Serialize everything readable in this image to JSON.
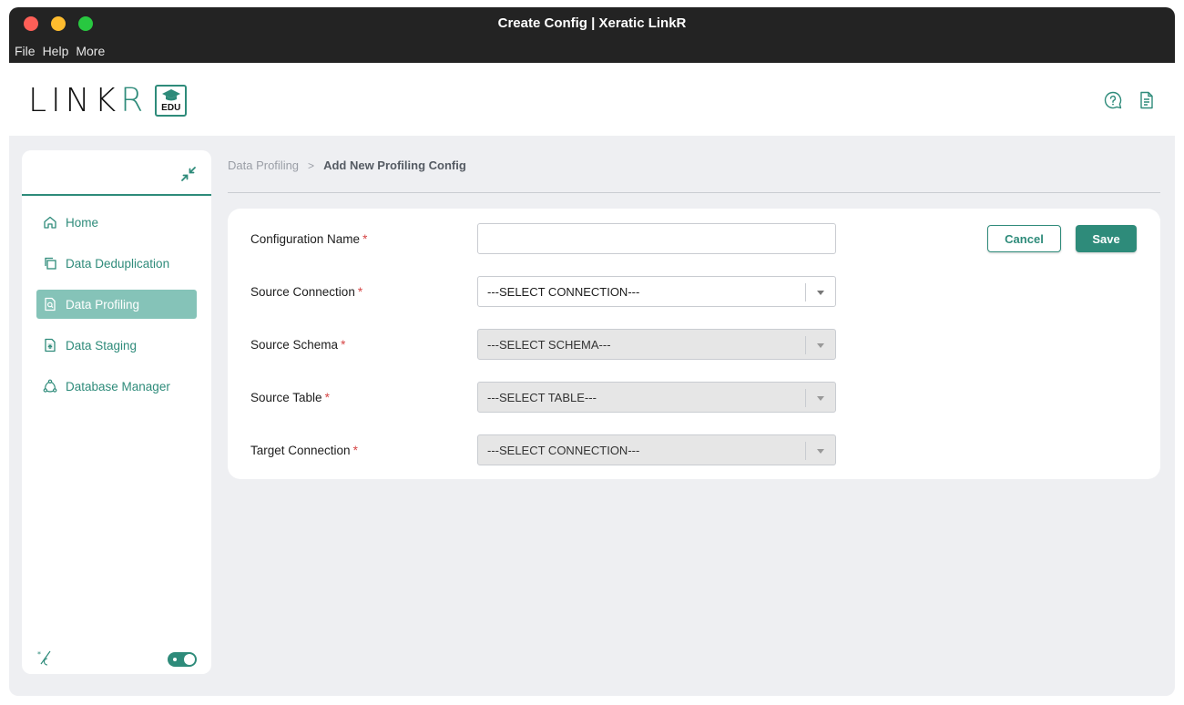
{
  "window": {
    "title": "Create Config | Xeratic LinkR",
    "menu": [
      "File",
      "Help",
      "More"
    ]
  },
  "header": {
    "logo_text_main": "LINK",
    "logo_text_r": "R",
    "logo_badge": "EDU",
    "icons": [
      "help-chat-icon",
      "document-icon"
    ]
  },
  "sidebar": {
    "collapse_icon": "collapse-arrows-icon",
    "items": [
      {
        "label": "Home",
        "icon": "home-icon",
        "active": false
      },
      {
        "label": "Data Deduplication",
        "icon": "copy-icon",
        "active": false
      },
      {
        "label": "Data Profiling",
        "icon": "file-search-icon",
        "active": true
      },
      {
        "label": "Data Staging",
        "icon": "file-upload-icon",
        "active": false
      },
      {
        "label": "Database Manager",
        "icon": "network-icon",
        "active": false
      }
    ],
    "bottom_icon": "brightness-contrast-icon",
    "theme_toggle_on": true
  },
  "breadcrumb": {
    "parent": "Data Profiling",
    "separator": ">",
    "current": "Add New Profiling Config"
  },
  "form": {
    "required_mark": "*",
    "fields": [
      {
        "label": "Configuration Name",
        "type": "text",
        "value": "",
        "placeholder": ""
      },
      {
        "label": "Source Connection",
        "type": "select",
        "value": "---SELECT CONNECTION---",
        "disabled": false
      },
      {
        "label": "Source Schema",
        "type": "select",
        "value": "---SELECT SCHEMA---",
        "disabled": true
      },
      {
        "label": "Source Table",
        "type": "select",
        "value": "---SELECT TABLE---",
        "disabled": true
      },
      {
        "label": "Target Connection",
        "type": "select",
        "value": "---SELECT CONNECTION---",
        "disabled": true
      }
    ],
    "cancel_label": "Cancel",
    "save_label": "Save"
  },
  "colors": {
    "accent": "#2e8b7a",
    "active_nav_bg": "#85c3b8",
    "titlebar": "#232323",
    "required": "#d64545"
  }
}
